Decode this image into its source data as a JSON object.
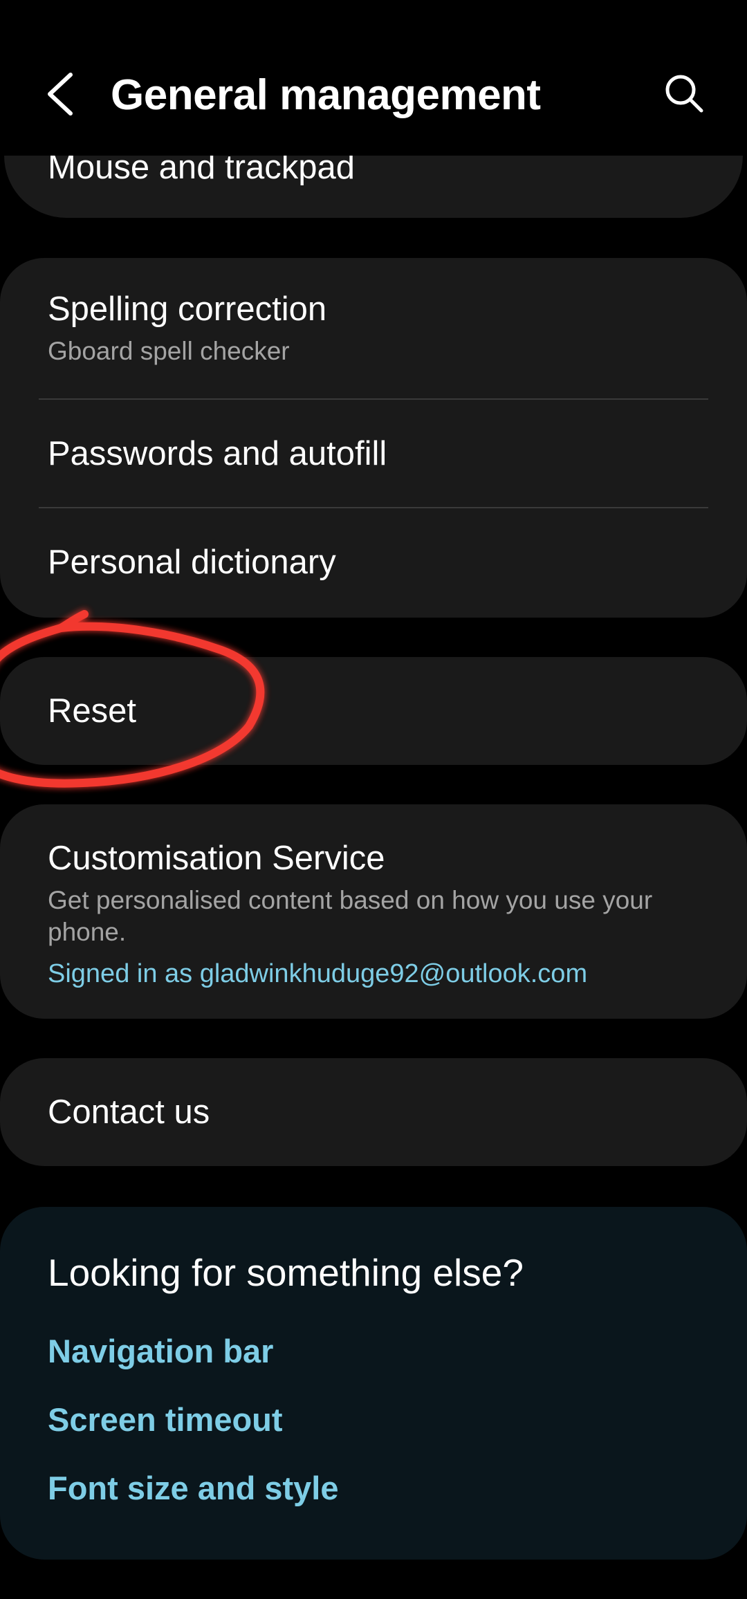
{
  "header": {
    "title": "General management",
    "back_icon": "chevron-left-icon",
    "search_icon": "search-icon"
  },
  "items": {
    "mouse": {
      "title": "Mouse and trackpad"
    },
    "spelling": {
      "title": "Spelling correction",
      "subtitle": "Gboard spell checker"
    },
    "passwords": {
      "title": "Passwords and autofill"
    },
    "dictionary": {
      "title": "Personal dictionary"
    },
    "reset": {
      "title": "Reset"
    },
    "customisation": {
      "title": "Customisation Service",
      "subtitle_line1": "Get personalised content based on how you use your",
      "subtitle_line2": "phone.",
      "signed_in": "Signed in as gladwinkhuduge92@outlook.com"
    },
    "contact": {
      "title": "Contact us"
    }
  },
  "suggestions": {
    "title": "Looking for something else?",
    "links": [
      "Navigation bar",
      "Screen timeout",
      "Font size and style"
    ]
  },
  "colors": {
    "background": "#000000",
    "card": "#1a1a1a",
    "suggestion_card": "#0a161c",
    "link": "#7ecde6",
    "subtitle": "#a4a4a4",
    "annotation": "#ff3b30"
  }
}
